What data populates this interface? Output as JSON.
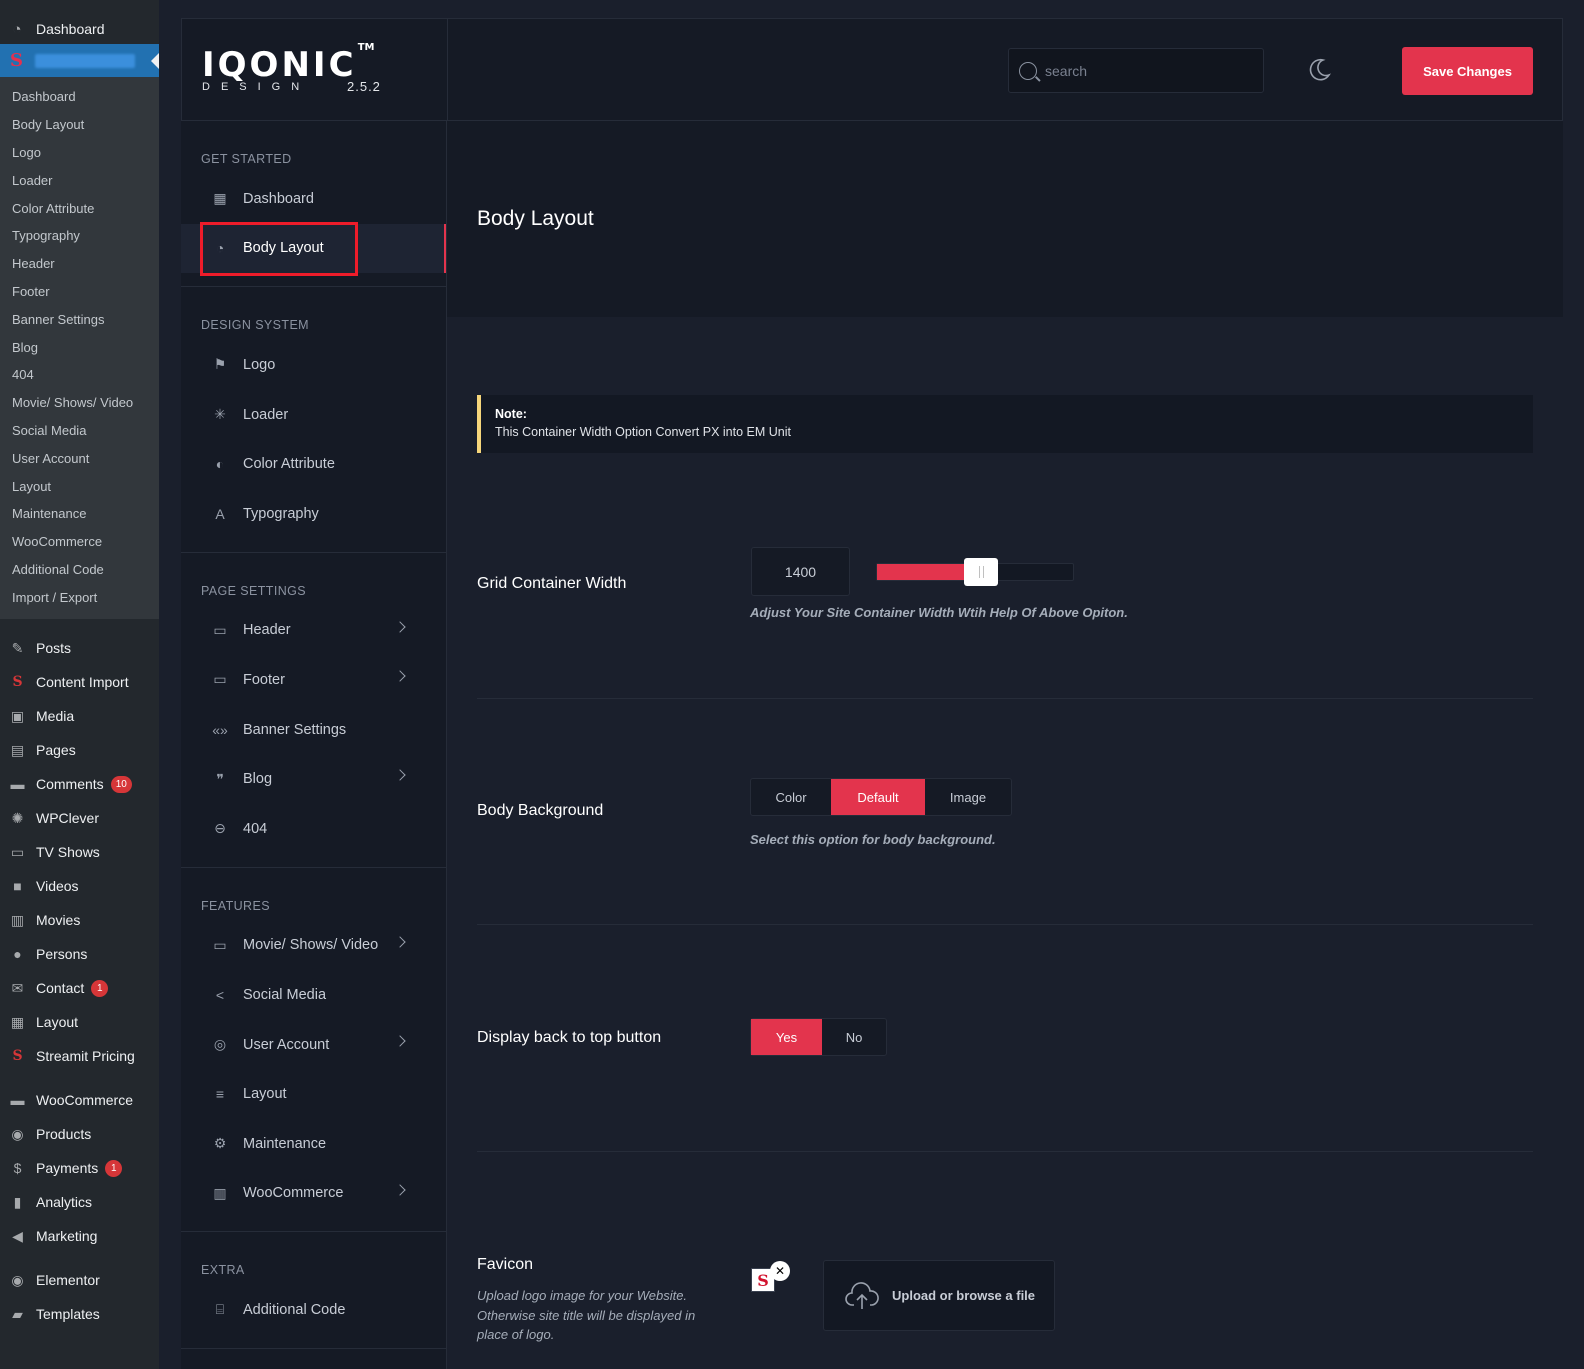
{
  "wp_sidebar": {
    "top_item": "Dashboard",
    "submenu": [
      "Dashboard",
      "Body Layout",
      "Logo",
      "Loader",
      "Color Attribute",
      "Typography",
      "Header",
      "Footer",
      "Banner Settings",
      "Blog",
      "404",
      "Movie/ Shows/ Video",
      "Social Media",
      "User Account",
      "Layout",
      "Maintenance",
      "WooCommerce",
      "Additional Code",
      "Import / Export"
    ],
    "menu": [
      {
        "label": "Posts",
        "icon": "pushpin-icon"
      },
      {
        "label": "Content Import",
        "icon": "streamit-s-icon"
      },
      {
        "label": "Media",
        "icon": "media-icon"
      },
      {
        "label": "Pages",
        "icon": "pages-icon"
      },
      {
        "label": "Comments",
        "icon": "comment-icon",
        "count": "10"
      },
      {
        "label": "WPClever",
        "icon": "bulb-icon"
      },
      {
        "label": "TV Shows",
        "icon": "tv-icon"
      },
      {
        "label": "Videos",
        "icon": "video-icon"
      },
      {
        "label": "Movies",
        "icon": "film-icon"
      },
      {
        "label": "Persons",
        "icon": "person-icon"
      },
      {
        "label": "Contact",
        "icon": "mail-icon",
        "count": "1"
      },
      {
        "label": "Layout",
        "icon": "layout-icon"
      },
      {
        "label": "Streamit Pricing",
        "icon": "streamit-s-icon"
      },
      {
        "label": "WooCommerce",
        "icon": "woo-icon"
      },
      {
        "label": "Products",
        "icon": "products-icon"
      },
      {
        "label": "Payments",
        "icon": "payments-icon",
        "count": "1"
      },
      {
        "label": "Analytics",
        "icon": "analytics-icon"
      },
      {
        "label": "Marketing",
        "icon": "megaphone-icon"
      },
      {
        "label": "Elementor",
        "icon": "elementor-icon"
      },
      {
        "label": "Templates",
        "icon": "folder-icon"
      }
    ]
  },
  "header": {
    "logo_text": "IQONIC",
    "logo_tm": "TM",
    "logo_sub": "DESIGN",
    "version": "2.5.2",
    "search_placeholder": "search",
    "save_label": "Save Changes"
  },
  "theme_nav": {
    "sections": [
      {
        "title": "GET STARTED",
        "items": [
          {
            "label": "Dashboard",
            "icon": "grid-icon",
            "chevron": false
          },
          {
            "label": "Body Layout",
            "icon": "gauge-icon",
            "chevron": false,
            "active": true
          }
        ]
      },
      {
        "title": "DESIGN SYSTEM",
        "items": [
          {
            "label": "Logo",
            "icon": "flag-icon",
            "chevron": false
          },
          {
            "label": "Loader",
            "icon": "loader-icon",
            "chevron": false
          },
          {
            "label": "Color Attribute",
            "icon": "contrast-icon",
            "chevron": false
          },
          {
            "label": "Typography",
            "icon": "typography-icon",
            "chevron": false
          }
        ]
      },
      {
        "title": "PAGE SETTINGS",
        "items": [
          {
            "label": "Header",
            "icon": "window-icon",
            "chevron": true
          },
          {
            "label": "Footer",
            "icon": "footer-icon",
            "chevron": true
          },
          {
            "label": "Banner Settings",
            "icon": "code-icon",
            "chevron": false
          },
          {
            "label": "Blog",
            "icon": "quote-icon",
            "chevron": true
          },
          {
            "label": "404",
            "icon": "minus-circle-icon",
            "chevron": false
          }
        ]
      },
      {
        "title": "FEATURES",
        "items": [
          {
            "label": "Movie/ Shows/ Video",
            "icon": "window-icon",
            "chevron": true
          },
          {
            "label": "Social Media",
            "icon": "share-icon",
            "chevron": false
          },
          {
            "label": "User Account",
            "icon": "user-circle-icon",
            "chevron": true
          },
          {
            "label": "Layout",
            "icon": "lines-icon",
            "chevron": false
          },
          {
            "label": "Maintenance",
            "icon": "user-gear-icon",
            "chevron": false
          },
          {
            "label": "WooCommerce",
            "icon": "store-icon",
            "chevron": true
          }
        ]
      },
      {
        "title": "EXTRA",
        "items": [
          {
            "label": "Additional Code",
            "icon": "code-file-icon",
            "chevron": false
          }
        ]
      }
    ]
  },
  "main": {
    "title": "Body Layout",
    "note_title": "Note:",
    "note_text": "This Container Width Option Convert PX into EM Unit",
    "grid_label": "Grid Container Width",
    "grid_value": "1400",
    "grid_slider_fraction": 0.45,
    "grid_hint": "Adjust Your Site Container Width Wtih Help Of Above Opiton.",
    "bg_label": "Body Background",
    "bg_options": [
      "Color",
      "Default",
      "Image"
    ],
    "bg_selected": "Default",
    "bg_hint": "Select this option for body background.",
    "top_label": "Display back to top button",
    "top_options": [
      "Yes",
      "No"
    ],
    "top_selected": "Yes",
    "fav_label": "Favicon",
    "fav_desc": "Upload logo image for your Website. Otherwise site title will be displayed in place of logo.",
    "upload_label": "Upload or browse a file"
  },
  "colors": {
    "accent": "#e3344d",
    "note_border": "#f6d67b",
    "bg": "#1a1f2c"
  }
}
